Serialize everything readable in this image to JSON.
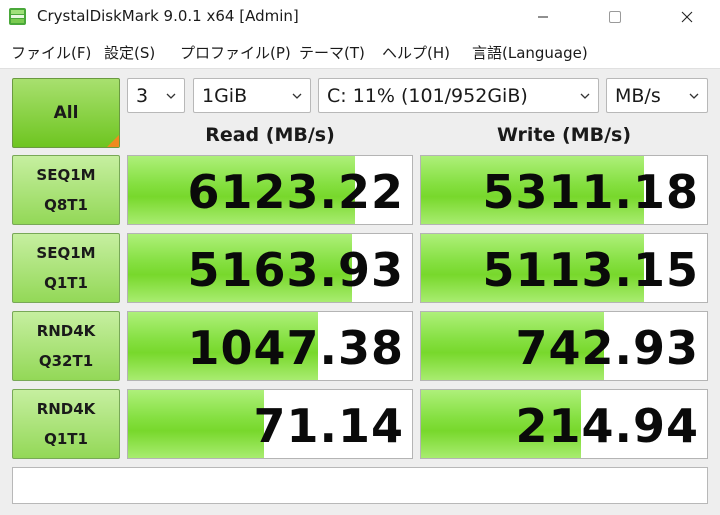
{
  "window": {
    "title": "CrystalDiskMark 9.0.1 x64 [Admin]"
  },
  "menu": {
    "items": [
      {
        "label": "ファイル(F)"
      },
      {
        "label": "設定(S)"
      },
      {
        "label": "プロファイル(P)"
      },
      {
        "label": "テーマ(T)"
      },
      {
        "label": "ヘルプ(H)"
      },
      {
        "label": "言語(Language)"
      }
    ]
  },
  "controls": {
    "all_label": "All",
    "count": "3",
    "size": "1GiB",
    "drive": "C: 11% (101/952GiB)",
    "unit": "MB/s"
  },
  "headers": {
    "read": "Read (MB/s)",
    "write": "Write (MB/s)"
  },
  "tests": [
    {
      "line1": "SEQ1M",
      "line2": "Q8T1",
      "read": "6123.22",
      "write": "5311.18",
      "read_fill": 0.8,
      "write_fill": 0.78
    },
    {
      "line1": "SEQ1M",
      "line2": "Q1T1",
      "read": "5163.93",
      "write": "5113.15",
      "read_fill": 0.79,
      "write_fill": 0.78
    },
    {
      "line1": "RND4K",
      "line2": "Q32T1",
      "read": "1047.38",
      "write": "742.93",
      "read_fill": 0.67,
      "write_fill": 0.64
    },
    {
      "line1": "RND4K",
      "line2": "Q1T1",
      "read": "71.14",
      "write": "214.94",
      "read_fill": 0.48,
      "write_fill": 0.56
    }
  ],
  "colors": {
    "bar_green": "#86e042",
    "all_corner": "#f08a1e",
    "titlebar_bg": "#ffffff"
  }
}
